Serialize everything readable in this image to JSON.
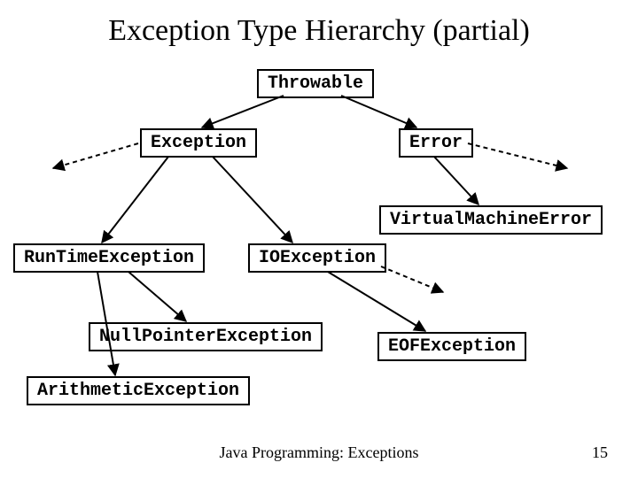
{
  "title": "Exception Type Hierarchy (partial)",
  "nodes": {
    "throwable": "Throwable",
    "exception": "Exception",
    "error": "Error",
    "vmerror": "VirtualMachineError",
    "runtime": "RunTimeException",
    "ioexception": "IOException",
    "nullpointer": "NullPointerException",
    "eof": "EOFException",
    "arithmetic": "ArithmeticException"
  },
  "footer": "Java Programming: Exceptions",
  "page": "15"
}
